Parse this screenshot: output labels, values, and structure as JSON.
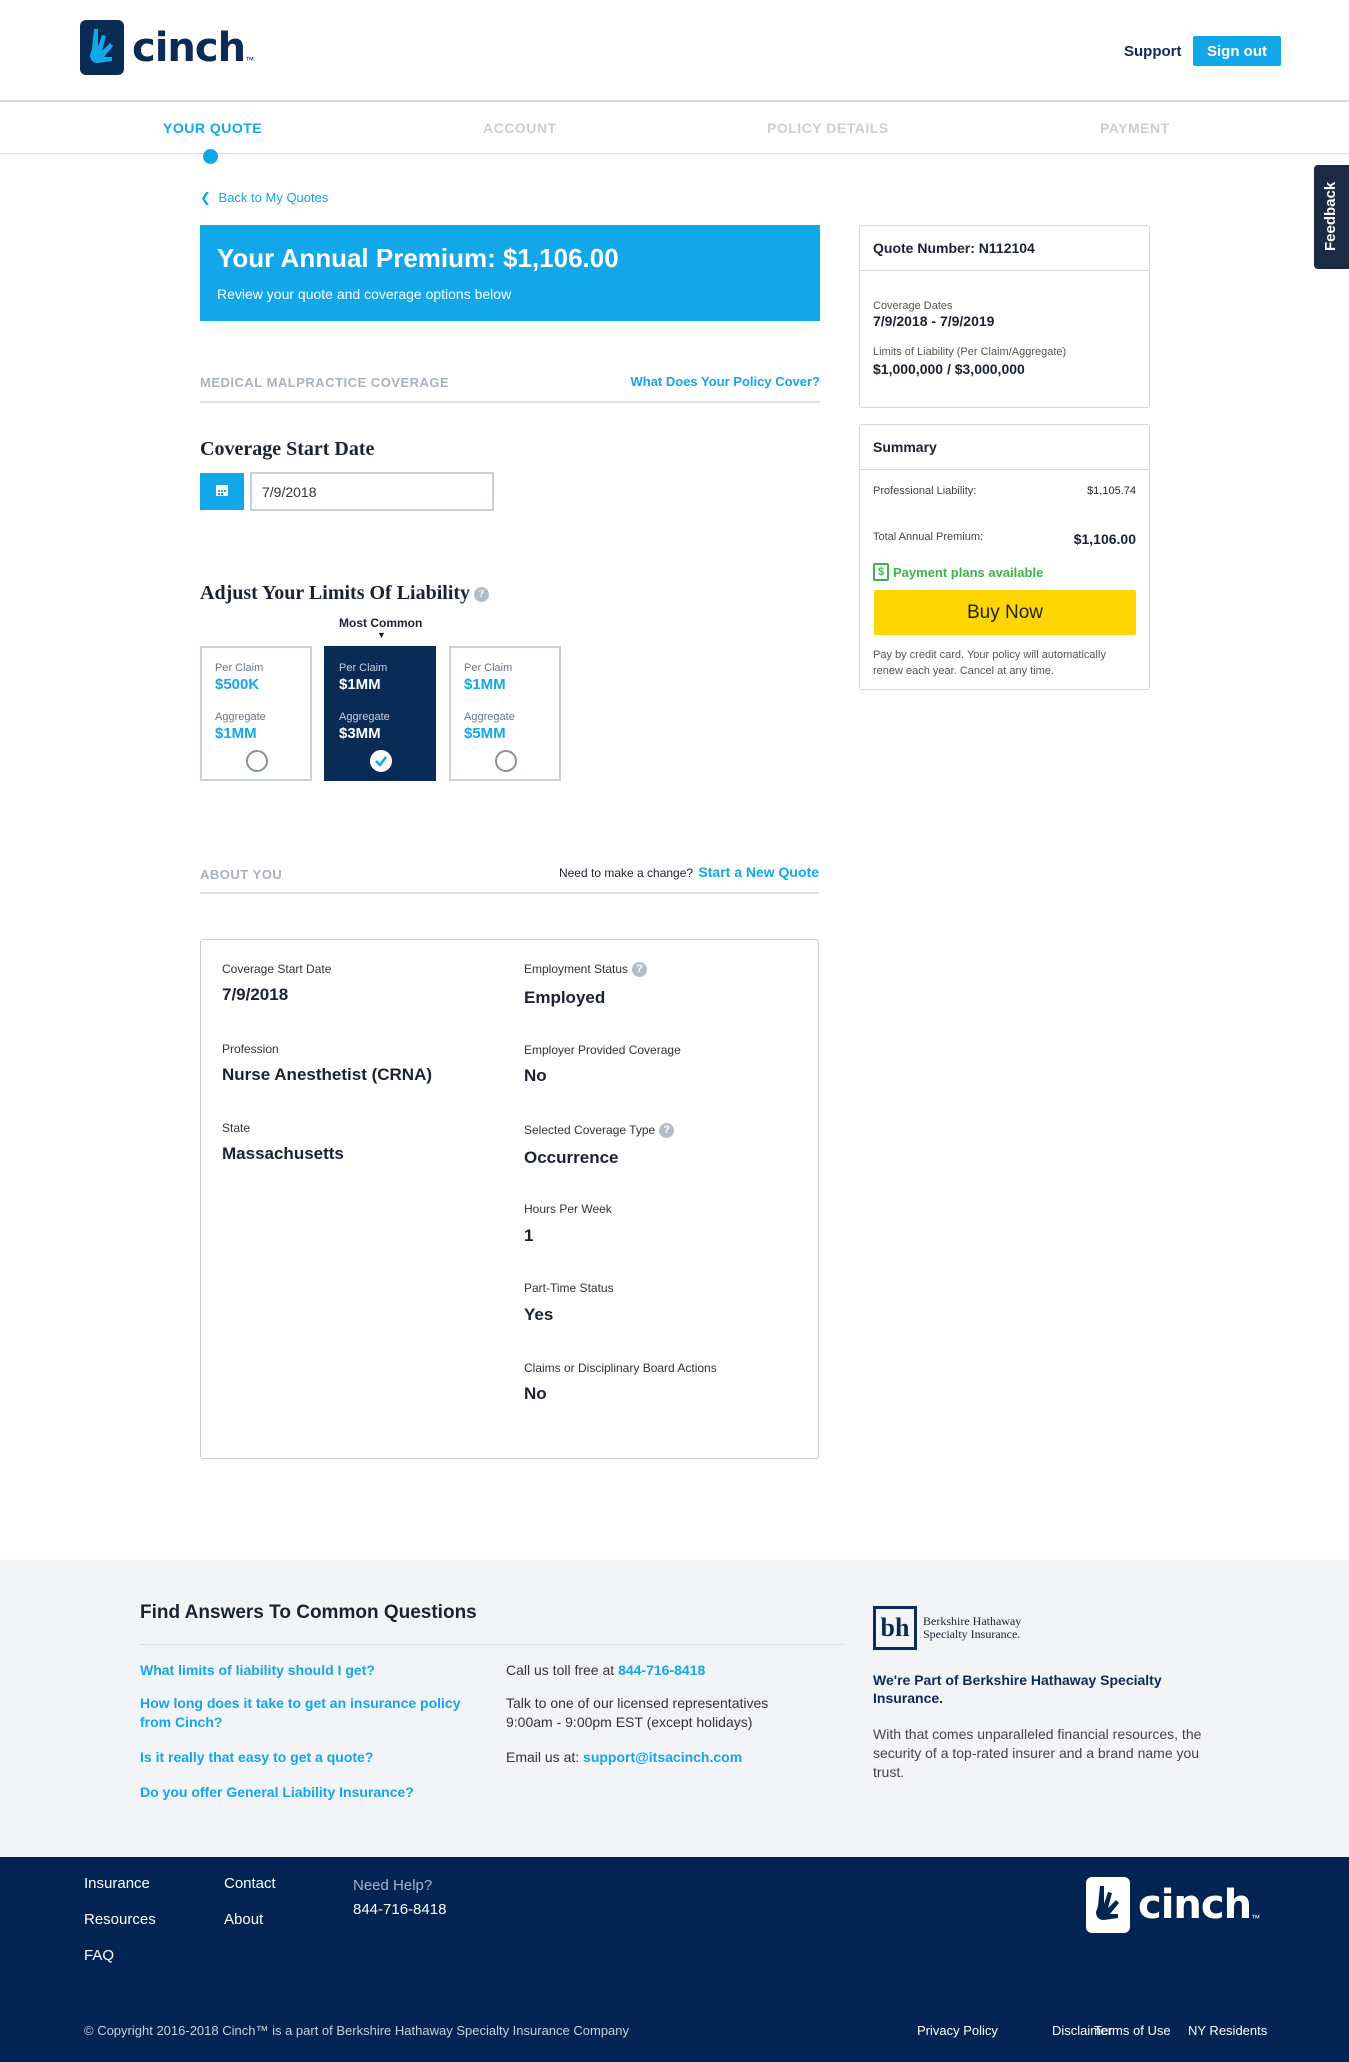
{
  "brand": {
    "name": "cinch",
    "tm": "™"
  },
  "header": {
    "support": "Support",
    "signout": "Sign out"
  },
  "steps": [
    "YOUR QUOTE",
    "ACCOUNT",
    "POLICY DETAILS",
    "PAYMENT"
  ],
  "feedback": "Feedback",
  "back_link": "Back to My Quotes",
  "premium": {
    "title": "Your Annual Premium: $1,106.00",
    "subtitle": "Review your quote and coverage options below"
  },
  "coverage_section": {
    "label": "MEDICAL MALPRACTICE COVERAGE",
    "link": "What Does Your Policy Cover?"
  },
  "start_date": {
    "heading": "Coverage Start Date",
    "value": "7/9/2018"
  },
  "limits": {
    "heading": "Adjust Your Limits Of Liability",
    "help": "?",
    "most_common": "Most Common",
    "options": [
      {
        "per_claim_label": "Per Claim",
        "per_claim": "$500K",
        "aggregate_label": "Aggregate",
        "aggregate": "$1MM",
        "selected": false
      },
      {
        "per_claim_label": "Per Claim",
        "per_claim": "$1MM",
        "aggregate_label": "Aggregate",
        "aggregate": "$3MM",
        "selected": true
      },
      {
        "per_claim_label": "Per Claim",
        "per_claim": "$1MM",
        "aggregate_label": "Aggregate",
        "aggregate": "$5MM",
        "selected": false
      }
    ]
  },
  "about": {
    "label": "ABOUT YOU",
    "change_text": "Need to make a change?",
    "change_link": "Start a New Quote",
    "left": [
      {
        "label": "Coverage Start Date",
        "value": "7/9/2018"
      },
      {
        "label": "Profession",
        "value": "Nurse Anesthetist (CRNA)"
      },
      {
        "label": "State",
        "value": "Massachusetts"
      }
    ],
    "right": [
      {
        "label": "Employment Status",
        "value": "Employed",
        "help": true
      },
      {
        "label": "Employer Provided Coverage",
        "value": "No",
        "help": false
      },
      {
        "label": "Selected Coverage Type",
        "value": "Occurrence",
        "help": true
      },
      {
        "label": "Hours Per Week",
        "value": "1",
        "help": false
      },
      {
        "label": "Part-Time Status",
        "value": "Yes",
        "help": false
      },
      {
        "label": "Claims or Disciplinary Board Actions",
        "value": "No",
        "help": false
      }
    ]
  },
  "quote_card": {
    "title": "Quote Number: N112104",
    "dates_label": "Coverage Dates",
    "dates": "7/9/2018 - 7/9/2019",
    "limits_label": "Limits of Liability (Per Claim/Aggregate)",
    "limits": "$1,000,000 / $3,000,000"
  },
  "summary": {
    "title": "Summary",
    "pl_label": "Professional Liability:",
    "pl_value": "$1,105.74",
    "total_label": "Total Annual Premium:",
    "total_value": "$1,106.00",
    "plans": "Payment plans available",
    "buy": "Buy Now",
    "note": "Pay by credit card. Your policy will automatically renew each year. Cancel at any time."
  },
  "faq": {
    "heading": "Find Answers To Common Questions",
    "questions": [
      "What limits of liability should I get?",
      "How long does it take to get an insurance policy from Cinch?",
      "Is it really that easy to get a quote?",
      "Do you offer General Liability Insurance?"
    ],
    "call_text": "Call us toll free at",
    "phone": "844-716-8418",
    "talk_text": "Talk to one of our licensed representatives 9:00am - 9:00pm EST (except holidays)",
    "email_text": "Email us at:",
    "email": "support@itsacinch.com",
    "bh_logo_line1": "Berkshire Hathaway",
    "bh_logo_line2": "Specialty Insurance.",
    "bh_heading": "We're Part of Berkshire Hathaway Specialty Insurance.",
    "bh_text": "With that comes unparalleled financial resources, the security of a top-rated insurer and a brand name you trust."
  },
  "footer": {
    "col1": [
      "Insurance",
      "Resources",
      "FAQ"
    ],
    "col2": [
      "Contact",
      "About"
    ],
    "help_label": "Need Help?",
    "help_phone": "844-716-8418",
    "copyright": "© Copyright 2016-2018 Cinch™ is a part of Berkshire Hathaway Specialty Insurance Company",
    "legal": [
      "Privacy Policy",
      "Disclaimer",
      "Terms of Use",
      "NY Residents"
    ]
  },
  "colors": {
    "accent": "#12a7e8",
    "navy": "#0b2b57",
    "buy": "#ffd500",
    "green": "#3db34a"
  }
}
